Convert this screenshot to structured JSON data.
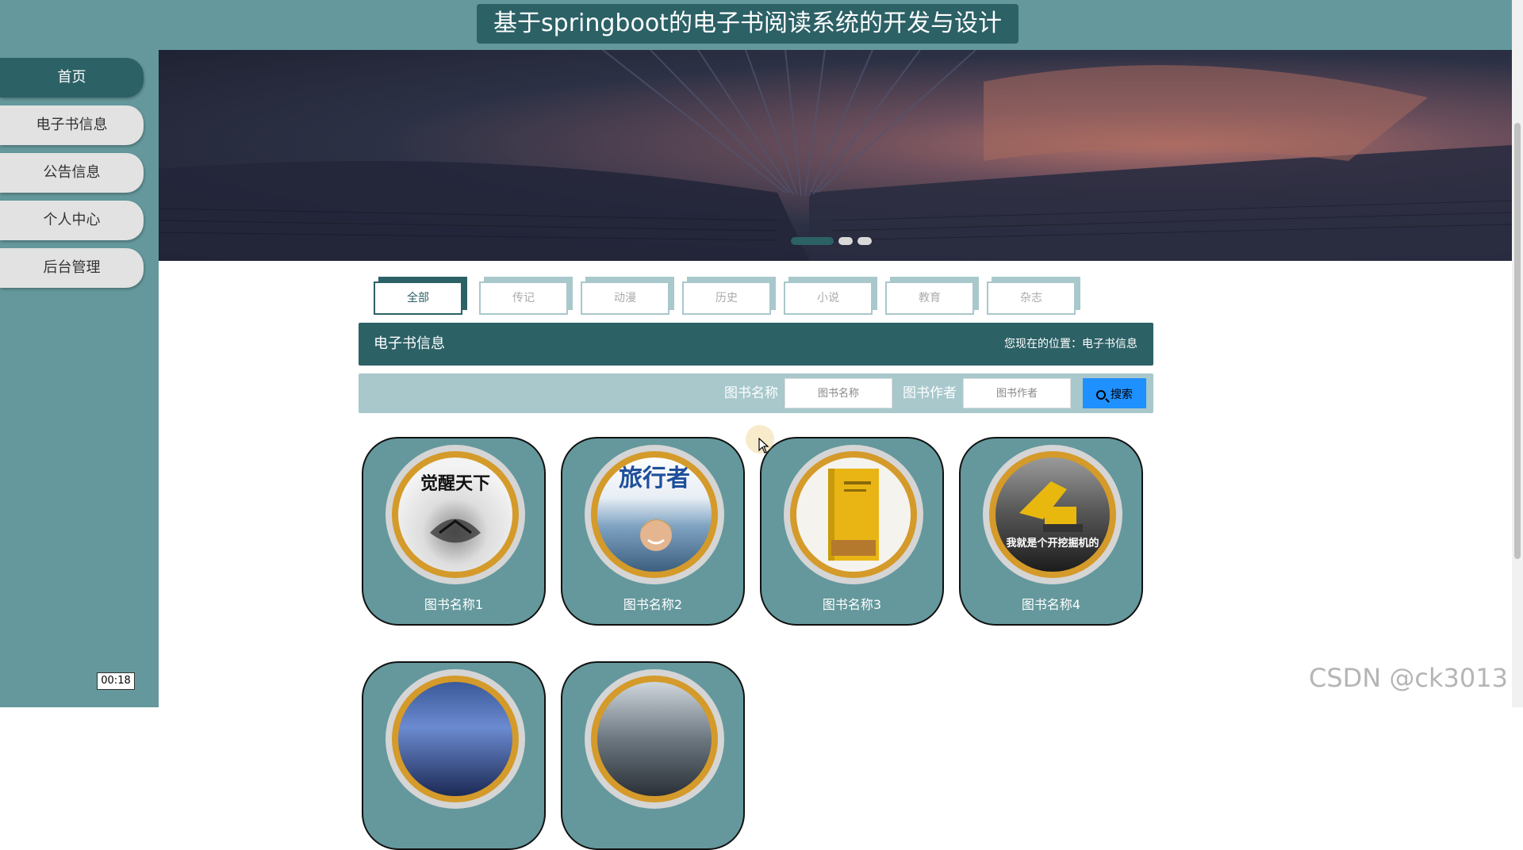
{
  "header": {
    "title": "基于springboot的电子书阅读系统的开发与设计"
  },
  "sidebar": {
    "items": [
      {
        "label": "首页",
        "active": true
      },
      {
        "label": "电子书信息",
        "active": false
      },
      {
        "label": "公告信息",
        "active": false
      },
      {
        "label": "个人中心",
        "active": false
      },
      {
        "label": "后台管理",
        "active": false
      }
    ]
  },
  "banner": {
    "slides": 3,
    "active_slide": 1
  },
  "tabs": [
    "全部",
    "传记",
    "动漫",
    "历史",
    "小说",
    "教育",
    "杂志"
  ],
  "active_tab": "全部",
  "section": {
    "title": "电子书信息",
    "breadcrumb": "您现在的位置：电子书信息"
  },
  "search": {
    "name_label": "图书名称",
    "name_placeholder": "图书名称",
    "author_label": "图书作者",
    "author_placeholder": "图书作者",
    "button_label": "搜索"
  },
  "books": [
    {
      "name": "图书名称1",
      "cover_text": "觉醒天下"
    },
    {
      "name": "图书名称2",
      "cover_text": "旅行者"
    },
    {
      "name": "图书名称3",
      "cover_text": ""
    },
    {
      "name": "图书名称4",
      "cover_text": "我就是个开挖掘机的"
    },
    {
      "name": "",
      "cover_text": ""
    },
    {
      "name": "",
      "cover_text": ""
    }
  ],
  "recording_timer": "00:18",
  "watermark": "CSDN @ck3013",
  "colors": {
    "primary": "#2c6166",
    "teal": "#64989c",
    "light_teal": "#a8c8cc",
    "search_button": "#1e90ff",
    "cover_ring": "#d49a2a"
  }
}
